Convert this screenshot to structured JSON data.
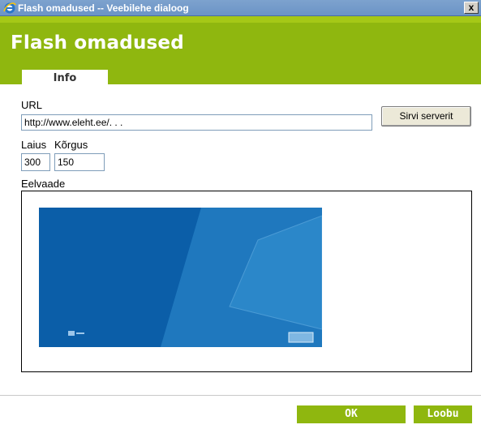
{
  "window": {
    "title": "Flash omadused -- Veebilehe dialoog",
    "close_label": "x"
  },
  "dialog": {
    "heading": "Flash omadused",
    "tabs": [
      {
        "label": "Info",
        "selected": true
      }
    ]
  },
  "form": {
    "url_label": "URL",
    "url_value": "http://www.eleht.ee/. . .",
    "browse_button": "Sirvi serverit",
    "width_label": "Laius",
    "width_value": "300",
    "height_label": "Kõrgus",
    "height_value": "150",
    "preview_label": "Eelvaade"
  },
  "footer": {
    "ok_label": "OK",
    "cancel_label": "Loobu"
  },
  "colors": {
    "accent_green": "#8fb70f",
    "titlebar_blue": "#6b94c6",
    "preview_blue": "#0b5ea8"
  },
  "icons": {
    "app_icon": "internet-explorer-icon"
  }
}
